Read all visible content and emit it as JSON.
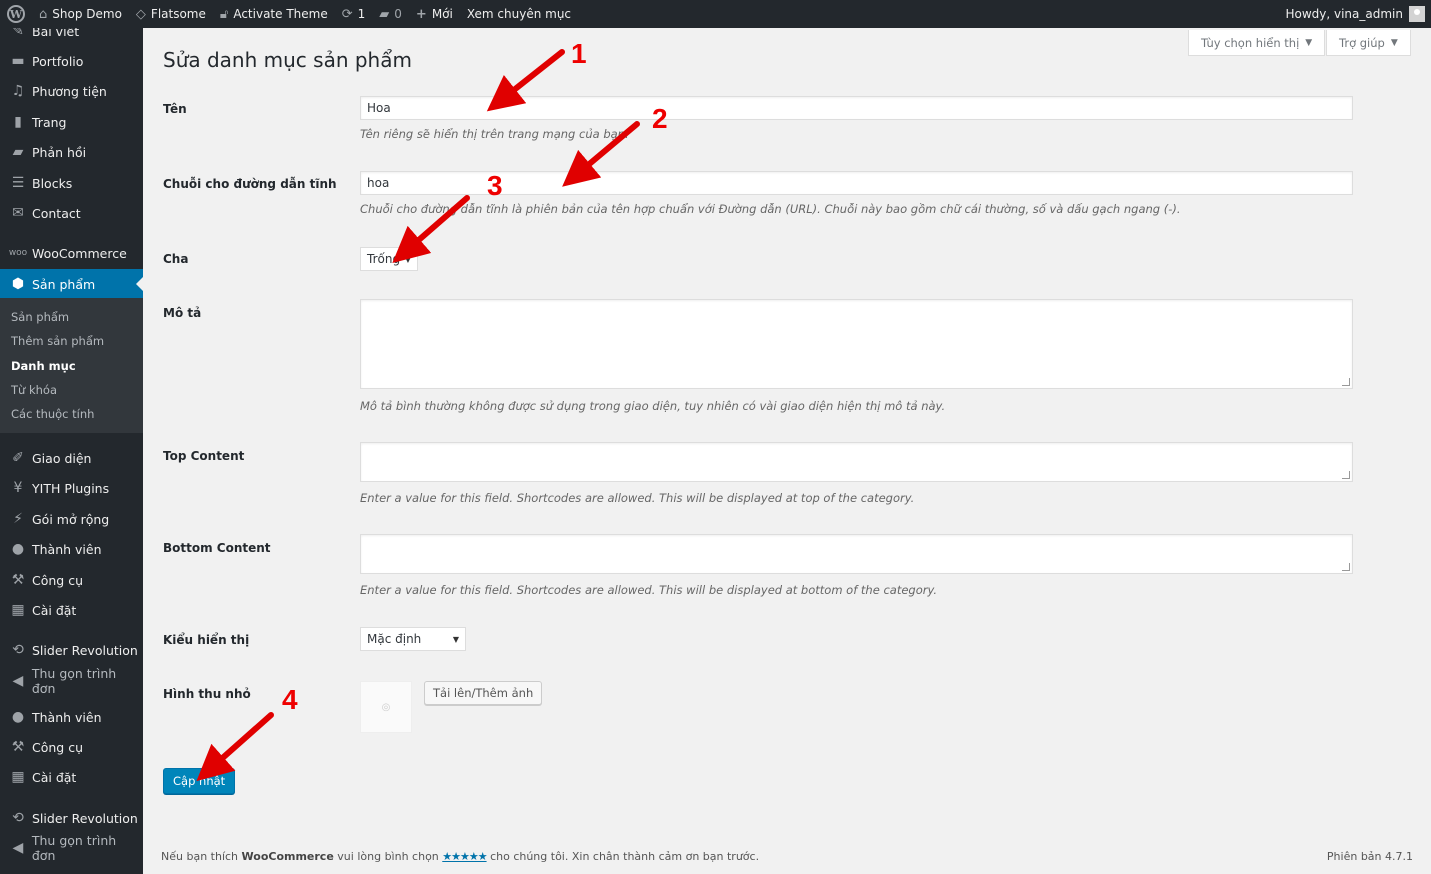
{
  "adminbar": {
    "site_name": "Shop Demo",
    "theme": "Flatsome",
    "activate_theme": "Activate Theme",
    "updates_count": "1",
    "comments_count": "0",
    "new_label": "Mới",
    "view_category": "Xem chuyên mục",
    "howdy": "Howdy, vina_admin"
  },
  "sidebar": {
    "partial_top": "Bài viết",
    "items": [
      {
        "label": "Portfolio"
      },
      {
        "label": "Phương tiện"
      },
      {
        "label": "Trang"
      },
      {
        "label": "Phản hồi"
      },
      {
        "label": "Blocks"
      },
      {
        "label": "Contact"
      },
      {
        "label": "WooCommerce"
      },
      {
        "label": "Sản phẩm"
      },
      {
        "label": "Giao diện"
      },
      {
        "label": "YITH Plugins"
      },
      {
        "label": "Gói mở rộng"
      },
      {
        "label": "Thành viên"
      },
      {
        "label": "Công cụ"
      },
      {
        "label": "Cài đặt"
      },
      {
        "label": "Slider Revolution"
      },
      {
        "label": "Thu gọn trình đơn"
      },
      {
        "label": "Thành viên"
      },
      {
        "label": "Công cụ"
      },
      {
        "label": "Cài đặt"
      },
      {
        "label": "Slider Revolution"
      },
      {
        "label": "Thu gọn trình đơn"
      }
    ],
    "submenu": [
      {
        "label": "Sản phẩm"
      },
      {
        "label": "Thêm sản phẩm"
      },
      {
        "label": "Danh mục"
      },
      {
        "label": "Từ khóa"
      },
      {
        "label": "Các thuộc tính"
      }
    ]
  },
  "header": {
    "screen_options": "Tùy chọn hiển thị",
    "help": "Trợ giúp",
    "title": "Sửa danh mục sản phẩm"
  },
  "form": {
    "name_label": "Tên",
    "name_value": "Hoa",
    "name_desc": "Tên riêng sẽ hiển thị trên trang mạng của bạn.",
    "slug_label": "Chuỗi cho đường dẫn tĩnh",
    "slug_value": "hoa",
    "slug_desc": "Chuỗi cho đường dẫn tĩnh là phiên bản của tên hợp chuẩn với Đường dẫn (URL). Chuỗi này bao gồm chữ cái thường, số và dấu gạch ngang (-).",
    "parent_label": "Cha",
    "parent_value": "Trống",
    "description_label": "Mô tả",
    "description_desc": "Mô tả bình thường không được sử dụng trong giao diện, tuy nhiên có vài giao diện hiện thị mô tả này.",
    "top_content_label": "Top Content",
    "top_content_desc": "Enter a value for this field. Shortcodes are allowed. This will be displayed at top of the category.",
    "bottom_content_label": "Bottom Content",
    "bottom_content_desc": "Enter a value for this field. Shortcodes are allowed. This will be displayed at bottom of the category.",
    "display_type_label": "Kiểu hiển thị",
    "display_type_value": "Mặc định",
    "thumbnail_label": "Hình thu nhỏ",
    "upload_button": "Tải lên/Thêm ảnh",
    "update_button": "Cập nhật"
  },
  "footer": {
    "prefix": "Nếu bạn thích ",
    "brand": "WooCommerce",
    "middle": " vui lòng bình chọn ",
    "stars": "★★★★★",
    "suffix": " cho chúng tôi. Xin chân thành cảm ơn bạn trước.",
    "version": "Phiên bản 4.7.1"
  },
  "annotations": [
    "1",
    "2",
    "3",
    "4"
  ],
  "colors": {
    "admin_dark": "#23282d",
    "accent": "#0073aa",
    "primary_button": "#0085ba",
    "arrow": "#e00000"
  }
}
